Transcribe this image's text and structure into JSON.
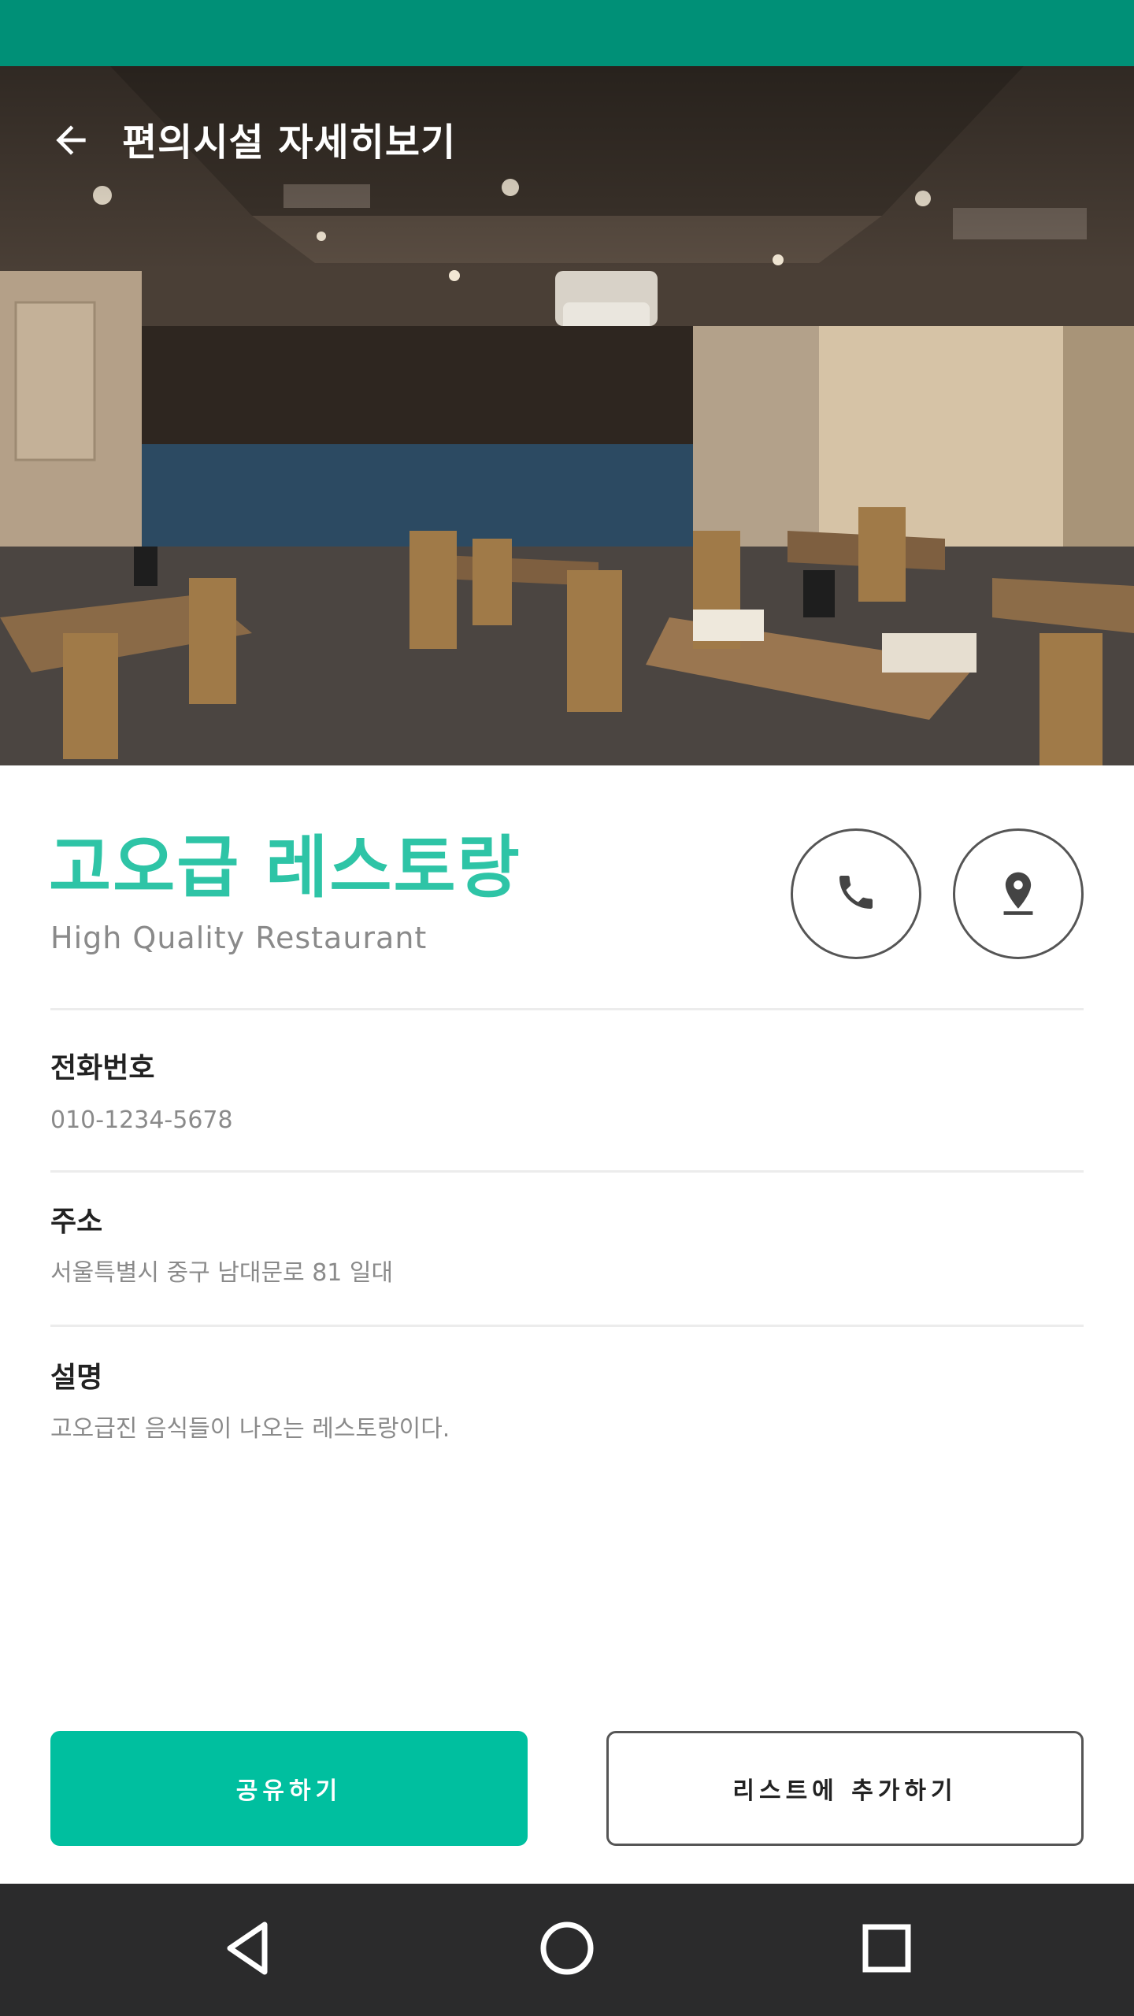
{
  "header": {
    "title": "편의시설 자세히보기",
    "back_icon": "arrow-left-icon"
  },
  "theme": {
    "status_bar_color": "#009077",
    "accent_color": "#2ec4a6",
    "primary_button_color": "#00bf9f",
    "nav_bar_color": "#2b2b2c"
  },
  "facility": {
    "name_ko": "고오급 레스토랑",
    "name_en": "High Quality Restaurant",
    "call_icon": "phone-icon",
    "location_icon": "location-pin-icon"
  },
  "info": {
    "phone_label": "전화번호",
    "phone_value": "010-1234-5678",
    "address_label": "주소",
    "address_value": "서울특별시 중구 남대문로 81 일대",
    "description_label": "설명",
    "description_value": "고오급진 음식들이 나오는 레스토랑이다."
  },
  "actions": {
    "share_label": "공유하기",
    "add_list_label": "리스트에 추가하기"
  },
  "nav": {
    "back_icon": "triangle-back-icon",
    "home_icon": "circle-home-icon",
    "recents_icon": "square-recents-icon"
  }
}
